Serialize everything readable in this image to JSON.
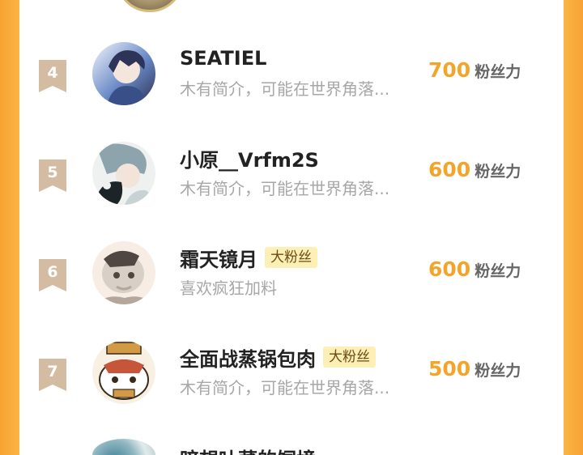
{
  "ranking": [
    {
      "rank": "4",
      "name": "SEATIEL",
      "badge": "",
      "intro": "木有简介，可能在世界角落...",
      "score": "700",
      "unit": "粉丝力",
      "avatar_palette": [
        "#f3f6fb",
        "#6a8ac7",
        "#2b3152"
      ]
    },
    {
      "rank": "5",
      "name": "小原__Vrfm2S",
      "badge": "",
      "intro": "木有简介，可能在世界角落...",
      "score": "600",
      "unit": "粉丝力",
      "avatar_palette": [
        "#eef1ef",
        "#8ea4ad",
        "#1d2428"
      ]
    },
    {
      "rank": "6",
      "name": "霜天镜月",
      "badge": "大粉丝",
      "intro": "喜欢疯狂加料",
      "score": "600",
      "unit": "粉丝力",
      "avatar_palette": [
        "#f7ede4",
        "#b4a69a",
        "#514742"
      ]
    },
    {
      "rank": "7",
      "name": "全面战蒸锅包肉",
      "badge": "大粉丝",
      "intro": "木有简介，可能在世界角落...",
      "score": "500",
      "unit": "粉丝力",
      "avatar_palette": [
        "#f8f0e2",
        "#d29a45",
        "#3b2a1a"
      ]
    }
  ],
  "next_item": {
    "name": "暗想吐菜的饲境"
  },
  "colors": {
    "page_background": "#fbb948",
    "score": "#f3a52b",
    "rank_badge": "#d4bca2",
    "fan_badge": "#fdf0b6"
  }
}
